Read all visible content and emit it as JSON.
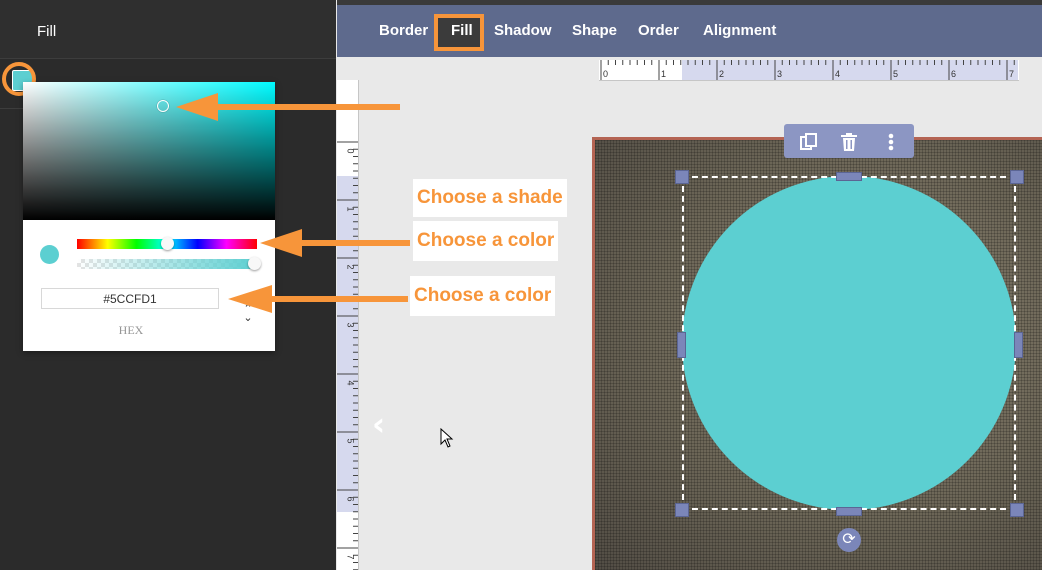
{
  "left_panel": {
    "title": "Fill"
  },
  "color_picker": {
    "hex_value": "#5CCFD1",
    "mode_label": "HEX",
    "current_color": "#5CCFD1",
    "hue_base_color": "#00fbff"
  },
  "toolbar": {
    "tabs": [
      {
        "label": "Border"
      },
      {
        "label": "Fill",
        "selected": true
      },
      {
        "label": "Shadow"
      },
      {
        "label": "Shape"
      },
      {
        "label": "Order"
      },
      {
        "label": "Alignment"
      }
    ]
  },
  "rulers": {
    "horizontal": [
      "0",
      "1",
      "2",
      "3",
      "4",
      "5",
      "6",
      "7"
    ],
    "vertical": [
      "0",
      "1",
      "2",
      "3",
      "4",
      "5",
      "6",
      "7"
    ]
  },
  "float_toolbar": {
    "icons": [
      "duplicate-icon",
      "trash-icon",
      "more-vertical-icon"
    ]
  },
  "callouts": {
    "shade": "Choose a shade",
    "color_hue": "Choose a color",
    "color_hex": "Choose a color"
  },
  "colors": {
    "accent": "#f7953a",
    "toolbar": "#5e6a8d",
    "shape_fill": "#5ccfd1"
  }
}
